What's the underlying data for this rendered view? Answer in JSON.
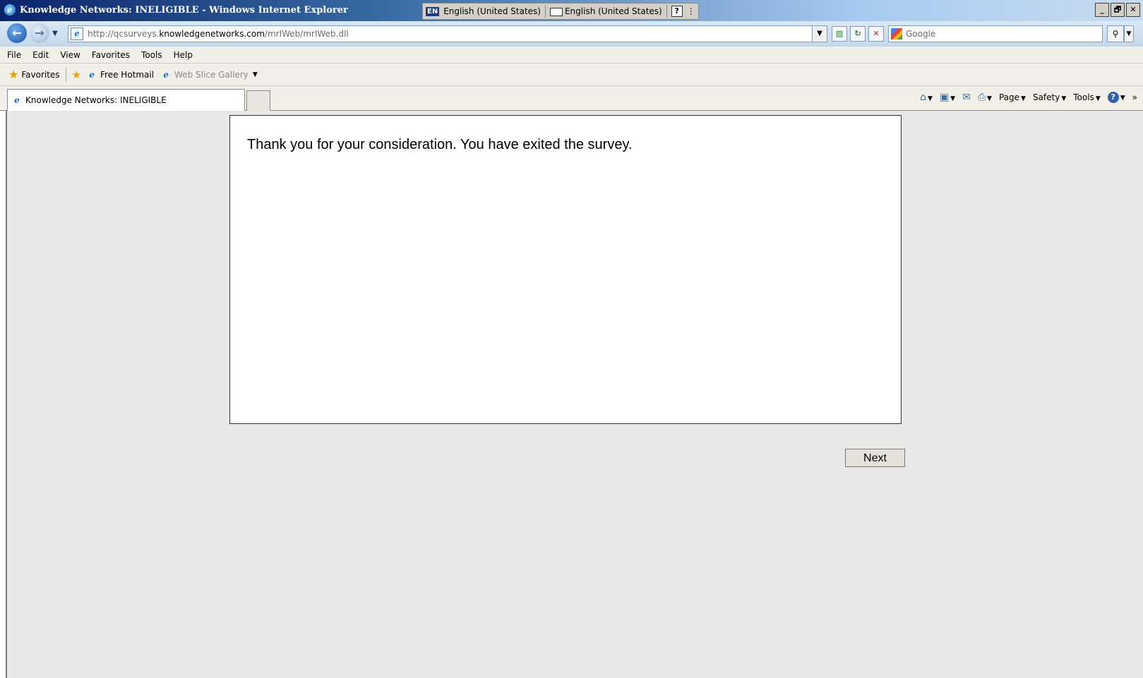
{
  "window": {
    "title": "Knowledge Networks: INELIGIBLE - Windows Internet Explorer",
    "controls": [
      "_",
      "🗗",
      "✕"
    ]
  },
  "langbar": {
    "badge": "EN",
    "language": "English (United States)",
    "keyboard": "English (United States)",
    "help": "?",
    "more": "⋮"
  },
  "address": {
    "url_prefix": "http://qcsurveys.",
    "url_domain": "knowledgenetworks.com",
    "url_path": "/mrIWeb/mrIWeb.dll"
  },
  "search": {
    "placeholder": "Google"
  },
  "menu": [
    "File",
    "Edit",
    "View",
    "Favorites",
    "Tools",
    "Help"
  ],
  "favorites": {
    "label": "Favorites",
    "links": [
      "Free Hotmail",
      "Web Slice Gallery"
    ]
  },
  "tab": {
    "title": "Knowledge Networks: INELIGIBLE"
  },
  "commandbar": {
    "page": "Page",
    "safety": "Safety",
    "tools": "Tools",
    "overflow": "»"
  },
  "content": {
    "message": "Thank you for your consideration. You have exited the survey.",
    "next_label": "Next"
  },
  "colors": {
    "page_background": "#e8e8e8",
    "panel_background": "#ffffff"
  },
  "icons": [
    "ie-logo-icon",
    "back-arrow-icon",
    "forward-arrow-icon",
    "compatibility-icon",
    "refresh-icon",
    "stop-icon",
    "google-icon",
    "search-icon",
    "star-icon",
    "add-favorite-icon",
    "home-icon",
    "feed-icon",
    "mail-icon",
    "print-icon",
    "help-icon"
  ]
}
